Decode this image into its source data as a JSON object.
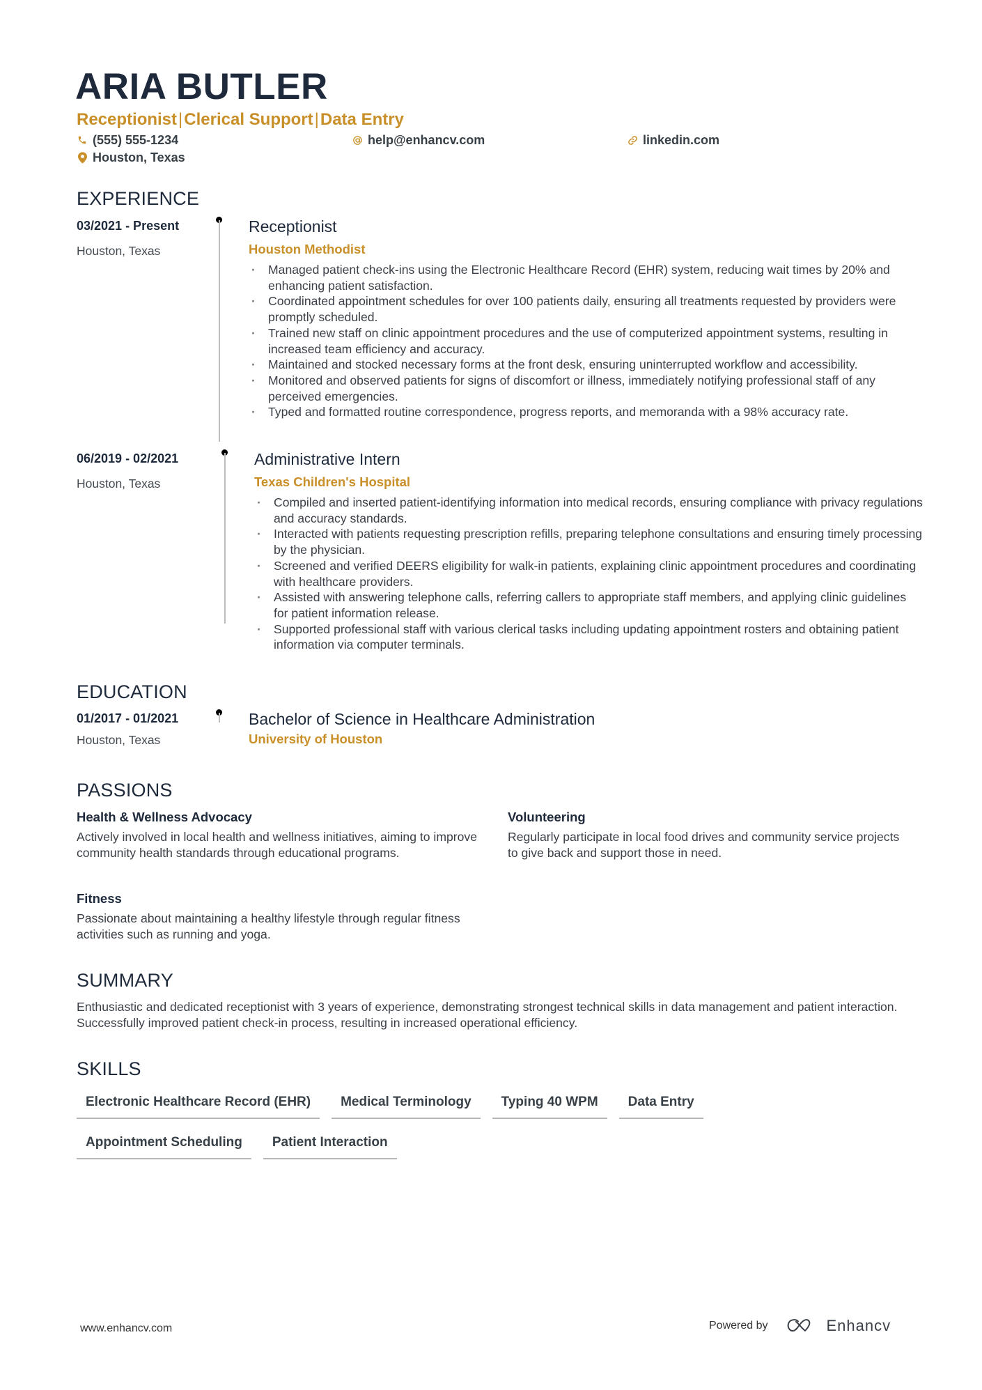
{
  "header": {
    "name": "ARIA BUTLER",
    "titles": [
      "Receptionist",
      "Clerical Support",
      "Data Entry"
    ],
    "separator": "|",
    "contacts": {
      "phone": {
        "icon": "phone-icon",
        "value": "(555) 555-1234"
      },
      "email": {
        "icon": "at-icon",
        "value": "help@enhancv.com"
      },
      "linkedin": {
        "icon": "link-icon",
        "value": "linkedin.com"
      },
      "location": {
        "icon": "location-pin-icon",
        "value": "Houston, Texas"
      }
    }
  },
  "colors": {
    "accent": "#c98f28",
    "heading": "#1e2a3b",
    "body": "#3b4048",
    "timeline": "#bdbdbd"
  },
  "experience": {
    "title": "EXPERIENCE",
    "items": [
      {
        "dates": "03/2021 - Present",
        "location": "Houston, Texas",
        "role": "Receptionist",
        "company": "Houston Methodist",
        "bullets": [
          "Managed patient check-ins using the Electronic Healthcare Record (EHR) system, reducing wait times by 20% and enhancing patient satisfaction.",
          "Coordinated appointment schedules for over 100 patients daily, ensuring all treatments requested by providers were promptly scheduled.",
          "Trained new staff on clinic appointment procedures and the use of computerized appointment systems, resulting in increased team efficiency and accuracy.",
          "Maintained and stocked necessary forms at the front desk, ensuring uninterrupted workflow and accessibility.",
          "Monitored and observed patients for signs of discomfort or illness, immediately notifying professional staff of any perceived emergencies.",
          "Typed and formatted routine correspondence, progress reports, and memoranda with a 98% accuracy rate."
        ]
      },
      {
        "dates": "06/2019 - 02/2021",
        "location": "Houston, Texas",
        "role": "Administrative Intern",
        "company": "Texas Children's Hospital",
        "bullets": [
          "Compiled and inserted patient-identifying information into medical records, ensuring compliance with privacy regulations and accuracy standards.",
          "Interacted with patients requesting prescription refills, preparing telephone consultations and ensuring timely processing by the physician.",
          "Screened and verified DEERS eligibility for walk-in patients, explaining clinic appointment procedures and coordinating with healthcare providers.",
          "Assisted with answering telephone calls, referring callers to appropriate staff members, and applying clinic guidelines for patient information release.",
          "Supported professional staff with various clerical tasks including updating appointment rosters and obtaining patient information via computer terminals."
        ]
      }
    ]
  },
  "education": {
    "title": "EDUCATION",
    "items": [
      {
        "dates": "01/2017 - 01/2021",
        "location": "Houston, Texas",
        "degree": "Bachelor of Science in Healthcare Administration",
        "school": "University of Houston"
      }
    ]
  },
  "passions": {
    "title": "PASSIONS",
    "items": [
      {
        "title": "Health & Wellness Advocacy",
        "description": "Actively involved in local health and wellness initiatives, aiming to improve community health standards through educational programs."
      },
      {
        "title": "Volunteering",
        "description": "Regularly participate in local food drives and community service projects to give back and support those in need."
      },
      {
        "title": "Fitness",
        "description": "Passionate about maintaining a healthy lifestyle through regular fitness activities such as running and yoga."
      }
    ]
  },
  "summary": {
    "title": "SUMMARY",
    "text": "Enthusiastic and dedicated receptionist with 3 years of experience, demonstrating strongest technical skills in data management and patient interaction. Successfully improved patient check-in process, resulting in increased operational efficiency."
  },
  "skills": {
    "title": "SKILLS",
    "rows": [
      [
        "Electronic Healthcare Record (EHR)",
        "Medical Terminology",
        "Typing 40 WPM",
        "Data Entry"
      ],
      [
        "Appointment Scheduling",
        "Patient Interaction"
      ]
    ]
  },
  "footer": {
    "website": "www.enhancv.com",
    "powered_by": "Powered by",
    "brand": "Enhancv",
    "brand_icon": "enhancv-logo-icon"
  }
}
